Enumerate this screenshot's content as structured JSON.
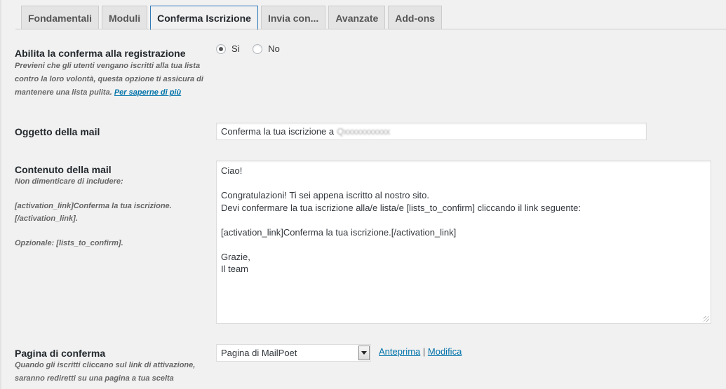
{
  "tabs": [
    {
      "label": "Fondamentali",
      "active": false
    },
    {
      "label": "Moduli",
      "active": false
    },
    {
      "label": "Conferma Iscrizione",
      "active": true
    },
    {
      "label": "Invia con...",
      "active": false
    },
    {
      "label": "Avanzate",
      "active": false
    },
    {
      "label": "Add-ons",
      "active": false
    }
  ],
  "confirmation": {
    "label": "Abilita la conferma alla registrazione",
    "description": "Previeni che gli utenti vengano iscritti alla tua lista contro la loro volontà, questa opzione ti assicura di mantenere una lista pulita.",
    "learn_more": "Per saperne di più",
    "option_yes": "Sì",
    "option_no": "No",
    "selected": "Sì"
  },
  "subject": {
    "label": "Oggetto della mail",
    "value": "Conferma la tua iscrizione a",
    "value_redacted": "Qxxxxxxxxxxx"
  },
  "content": {
    "label": "Contenuto della mail",
    "desc_line1": "Non dimenticare di includere:",
    "desc_line2": "[activation_link]Conferma la tua iscrizione.",
    "desc_line3": "[/activation_link].",
    "desc_line4": "Opzionale: [lists_to_confirm].",
    "lines": [
      "Ciao!",
      "",
      "Congratulazioni! Ti sei appena iscritto al nostro sito.",
      "Devi confermare la tua iscrizione alla/e lista/e [lists_to_confirm] cliccando il link seguente:",
      "",
      "[activation_link]Conferma la tua iscrizione.[/activation_link]",
      "",
      "Grazie,",
      "Il team"
    ]
  },
  "confirm_page": {
    "label": "Pagina di conferma",
    "desc_line1": "Quando gli iscritti cliccano sul link di attivazione,",
    "desc_line2": "saranno rediretti su una pagina a tua scelta",
    "selected": "Pagina di MailPoet",
    "preview_link": "Anteprima",
    "separator": "|",
    "edit_link": "Modifica"
  }
}
